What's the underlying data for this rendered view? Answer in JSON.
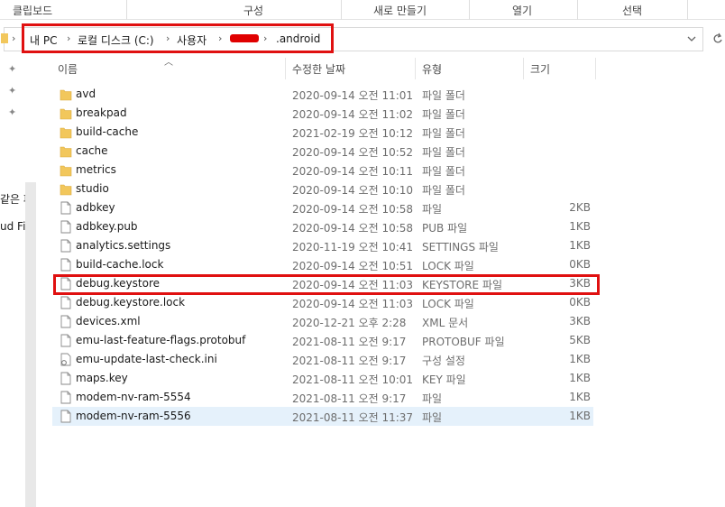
{
  "ribbon": {
    "groups": [
      "클립보드",
      "구성",
      "새로 만들기",
      "열기",
      "선택"
    ]
  },
  "address": {
    "crumbs": [
      "내 PC",
      "로컬 디스크 (C:)",
      "사용자",
      ".android"
    ],
    "chevron": "›",
    "dropdown_icon": "chevron-down-icon",
    "refresh_icon": "refresh-icon"
  },
  "nav": {
    "partial_items": [
      "같은 파",
      "ud Fil"
    ]
  },
  "columns": {
    "name": "이름",
    "date": "수정한 날짜",
    "type": "유형",
    "size": "크기"
  },
  "files": [
    {
      "name": "avd",
      "date": "2020-09-14 오전 11:01",
      "type": "파일 폴더",
      "size": "",
      "icon": "folder-icon"
    },
    {
      "name": "breakpad",
      "date": "2020-09-14 오전 11:02",
      "type": "파일 폴더",
      "size": "",
      "icon": "folder-icon"
    },
    {
      "name": "build-cache",
      "date": "2021-02-19 오전 10:12",
      "type": "파일 폴더",
      "size": "",
      "icon": "folder-icon"
    },
    {
      "name": "cache",
      "date": "2020-09-14 오전 10:52",
      "type": "파일 폴더",
      "size": "",
      "icon": "folder-icon"
    },
    {
      "name": "metrics",
      "date": "2020-09-14 오전 10:11",
      "type": "파일 폴더",
      "size": "",
      "icon": "folder-icon"
    },
    {
      "name": "studio",
      "date": "2020-09-14 오전 10:10",
      "type": "파일 폴더",
      "size": "",
      "icon": "folder-icon"
    },
    {
      "name": "adbkey",
      "date": "2020-09-14 오전 10:58",
      "type": "파일",
      "size": "2KB",
      "icon": "file-icon"
    },
    {
      "name": "adbkey.pub",
      "date": "2020-09-14 오전 10:58",
      "type": "PUB 파일",
      "size": "1KB",
      "icon": "file-icon"
    },
    {
      "name": "analytics.settings",
      "date": "2020-11-19 오전 10:41",
      "type": "SETTINGS 파일",
      "size": "1KB",
      "icon": "file-icon"
    },
    {
      "name": "build-cache.lock",
      "date": "2020-09-14 오전 10:51",
      "type": "LOCK 파일",
      "size": "0KB",
      "icon": "file-icon"
    },
    {
      "name": "debug.keystore",
      "date": "2020-09-14 오전 11:03",
      "type": "KEYSTORE 파일",
      "size": "3KB",
      "icon": "file-icon"
    },
    {
      "name": "debug.keystore.lock",
      "date": "2020-09-14 오전 11:03",
      "type": "LOCK 파일",
      "size": "0KB",
      "icon": "file-icon"
    },
    {
      "name": "devices.xml",
      "date": "2020-12-21 오후 2:28",
      "type": "XML 문서",
      "size": "3KB",
      "icon": "file-icon"
    },
    {
      "name": "emu-last-feature-flags.protobuf",
      "date": "2021-08-11 오전 9:17",
      "type": "PROTOBUF 파일",
      "size": "5KB",
      "icon": "file-icon"
    },
    {
      "name": "emu-update-last-check.ini",
      "date": "2021-08-11 오전 9:17",
      "type": "구성 설정",
      "size": "1KB",
      "icon": "settings-file-icon"
    },
    {
      "name": "maps.key",
      "date": "2021-08-11 오전 10:01",
      "type": "KEY 파일",
      "size": "1KB",
      "icon": "file-icon"
    },
    {
      "name": "modem-nv-ram-5554",
      "date": "2021-08-11 오전 9:17",
      "type": "파일",
      "size": "1KB",
      "icon": "file-icon"
    },
    {
      "name": "modem-nv-ram-5556",
      "date": "2021-08-11 오전 11:37",
      "type": "파일",
      "size": "1KB",
      "icon": "file-icon"
    }
  ],
  "colors": {
    "highlight": "#e01010",
    "selection": "#e5f1fb",
    "folder": "#f2c75c"
  }
}
